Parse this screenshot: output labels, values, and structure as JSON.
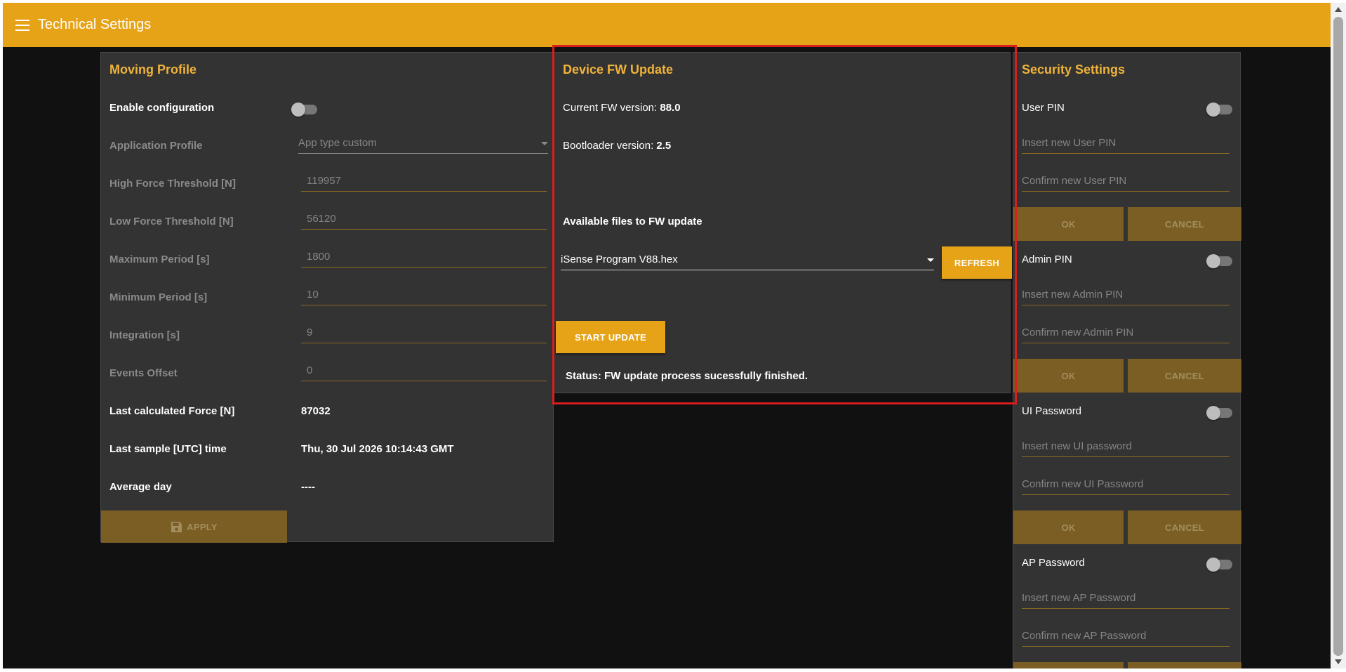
{
  "app": {
    "title": "Technical Settings"
  },
  "moving_profile": {
    "title": "Moving Profile",
    "enable_label": "Enable configuration",
    "application_profile": {
      "label": "Application Profile",
      "value": "App type custom"
    },
    "fields": [
      {
        "label": "High Force Threshold [N]",
        "value": "119957"
      },
      {
        "label": "Low Force Threshold [N]",
        "value": "56120"
      },
      {
        "label": "Maximum Period [s]",
        "value": "1800"
      },
      {
        "label": "Minimum Period [s]",
        "value": "10"
      },
      {
        "label": "Integration [s]",
        "value": "9"
      },
      {
        "label": "Events Offset",
        "value": "0"
      }
    ],
    "readouts": [
      {
        "label": "Last calculated Force [N]",
        "value": "87032"
      },
      {
        "label": "Last sample [UTC] time",
        "value": "Thu, 30 Jul 2026 10:14:43 GMT"
      },
      {
        "label": "Average day",
        "value": "----"
      }
    ],
    "apply_label": "APPLY"
  },
  "fw_update": {
    "title": "Device FW Update",
    "current_fw_label": "Current FW version: ",
    "current_fw_value": "88.0",
    "bootloader_label": "Bootloader version: ",
    "bootloader_value": "2.5",
    "available_label": "Available files to FW update",
    "selected_file": "iSense Program V88.hex",
    "refresh_label": "REFRESH",
    "start_label": "START UPDATE",
    "status": "Status: FW update process sucessfully finished."
  },
  "security": {
    "title": "Security Settings",
    "sections": [
      {
        "label": "User PIN",
        "new_placeholder": "Insert new User PIN",
        "confirm_placeholder": "Confirm new User PIN",
        "ok": "OK",
        "cancel": "CANCEL"
      },
      {
        "label": "Admin PIN",
        "new_placeholder": "Insert new Admin PIN",
        "confirm_placeholder": "Confirm new Admin PIN",
        "ok": "OK",
        "cancel": "CANCEL"
      },
      {
        "label": "UI Password",
        "new_placeholder": "Insert new UI password",
        "confirm_placeholder": "Confirm new UI Password",
        "ok": "OK",
        "cancel": "CANCEL"
      },
      {
        "label": "AP Password",
        "new_placeholder": "Insert new AP Password",
        "confirm_placeholder": "Confirm new AP Password"
      }
    ]
  },
  "colors": {
    "accent": "#e6a317",
    "panel": "#333333",
    "background": "#111111",
    "highlight": "#d81e1e"
  }
}
